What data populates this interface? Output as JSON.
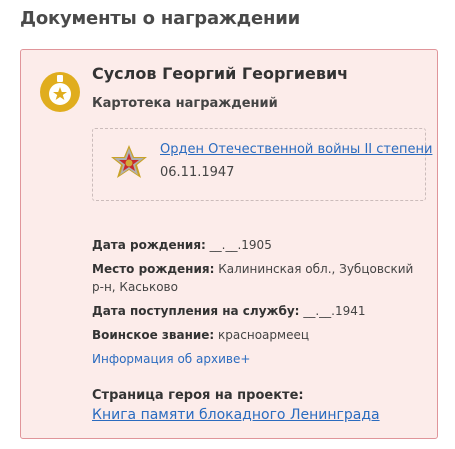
{
  "section": {
    "title": "Документы о награждении"
  },
  "card": {
    "name": "Суслов Георгий Георгиевич",
    "type": "Картотека награждений",
    "emblem_icon": "medal-star-icon",
    "award": {
      "icon": "order-patriotic-war-icon",
      "title": "Орден Отечественной войны II степени",
      "date": "06.11.1947"
    },
    "details": {
      "birth_date_label": "Дата рождения:",
      "birth_date_value": "__.__.1905",
      "birth_place_label": "Место рождения:",
      "birth_place_value": "Калининская обл., Зубцовский р-н, Каськово",
      "service_date_label": "Дата поступления на службу:",
      "service_date_value": "__.__.1941",
      "rank_label": "Воинское звание:",
      "rank_value": "красноармеец",
      "archive_link": "Информация об архиве+"
    },
    "hero": {
      "title": "Страница героя на проекте:",
      "link": "Книга памяти блокадного Ленинграда"
    }
  },
  "colors": {
    "card_background": "#fcecea",
    "card_border": "#e0959a",
    "link": "#2a6bbf",
    "emblem": "#e0ad1e"
  }
}
